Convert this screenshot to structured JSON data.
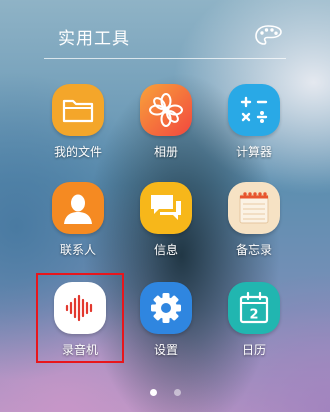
{
  "folder": {
    "title": "实用工具",
    "icon": "palette-icon"
  },
  "apps": [
    {
      "name": "我的文件",
      "icon": "folder-icon",
      "color": "#f4a62a"
    },
    {
      "name": "相册",
      "icon": "flower-icon",
      "color": "#f56b3a"
    },
    {
      "name": "计算器",
      "icon": "calculator-icon",
      "color": "#29a9e6"
    },
    {
      "name": "联系人",
      "icon": "person-icon",
      "color": "#f58a22"
    },
    {
      "name": "信息",
      "icon": "chat-bubble-icon",
      "color": "#f7b71a"
    },
    {
      "name": "备忘录",
      "icon": "notepad-icon",
      "color": "#f6e2c4"
    },
    {
      "name": "录音机",
      "icon": "soundwave-icon",
      "color": "#ffffff"
    },
    {
      "name": "设置",
      "icon": "gear-icon",
      "color": "#2f86e0"
    },
    {
      "name": "日历",
      "icon": "calendar-icon",
      "color": "#21b6b0"
    }
  ],
  "calendar_day": "2",
  "highlighted_app": "录音机",
  "pagination": {
    "total": 2,
    "current": 1
  },
  "colors": {
    "highlight": "#e8161c"
  }
}
